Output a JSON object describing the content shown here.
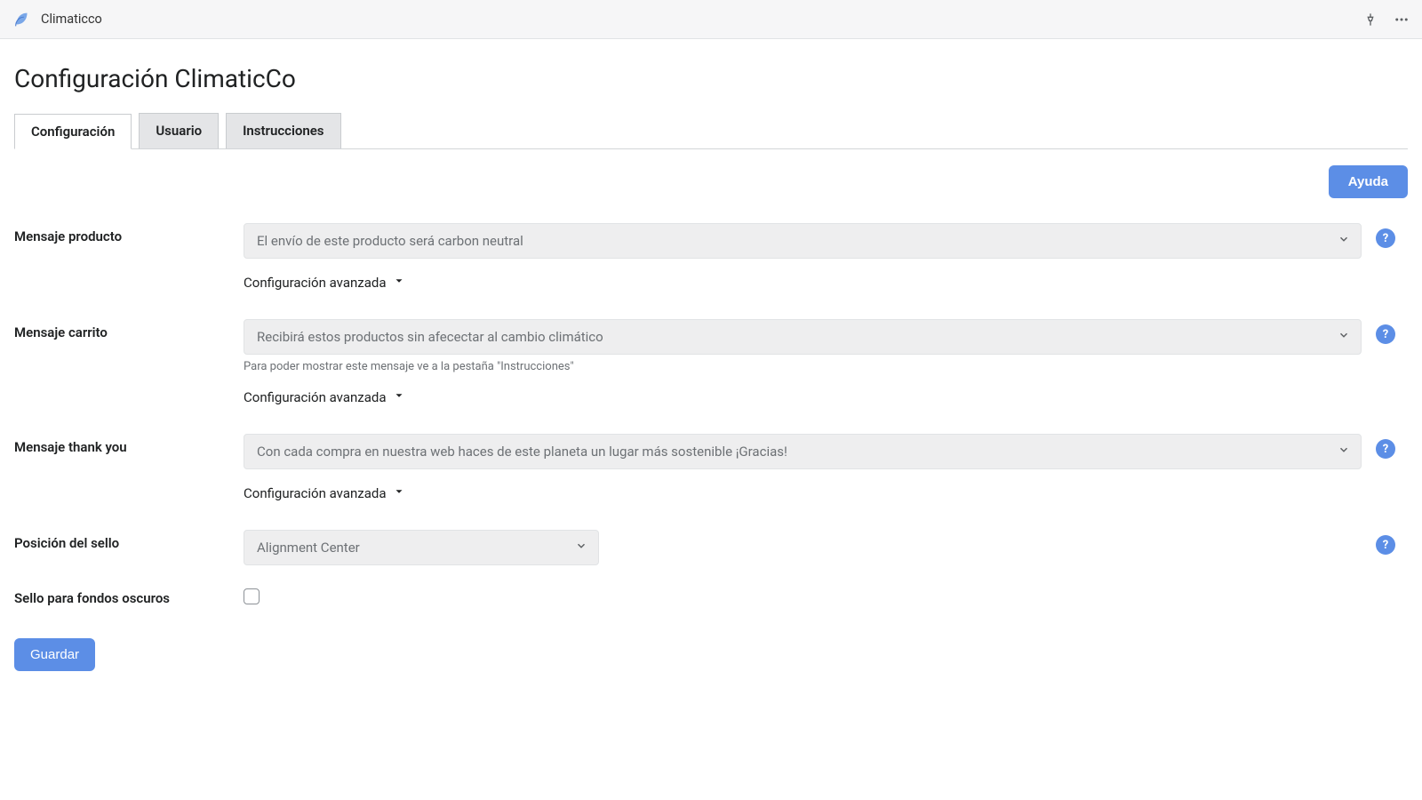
{
  "topbar": {
    "app_name": "Climaticco"
  },
  "page": {
    "title": "Configuración ClimaticCo"
  },
  "tabs": {
    "items": [
      "Configuración",
      "Usuario",
      "Instrucciones"
    ],
    "active_index": 0
  },
  "buttons": {
    "help": "Ayuda",
    "save": "Guardar"
  },
  "fields": {
    "product_message": {
      "label": "Mensaje producto",
      "value": "El envío de este producto será carbon neutral",
      "advanced_label": "Configuración avanzada"
    },
    "cart_message": {
      "label": "Mensaje carrito",
      "value": "Recibirá estos productos sin afecectar al cambio climático",
      "hint": "Para poder mostrar este mensaje ve a la pestaña \"Instrucciones\"",
      "advanced_label": "Configuración avanzada"
    },
    "thankyou_message": {
      "label": "Mensaje thank you",
      "value": "Con cada compra en nuestra web haces de este planeta un lugar más sostenible ¡Gracias!",
      "advanced_label": "Configuración avanzada"
    },
    "seal_position": {
      "label": "Posición del sello",
      "value": "Alignment Center"
    },
    "dark_seal": {
      "label": "Sello para fondos oscuros",
      "checked": false
    }
  },
  "help_badge_char": "?"
}
